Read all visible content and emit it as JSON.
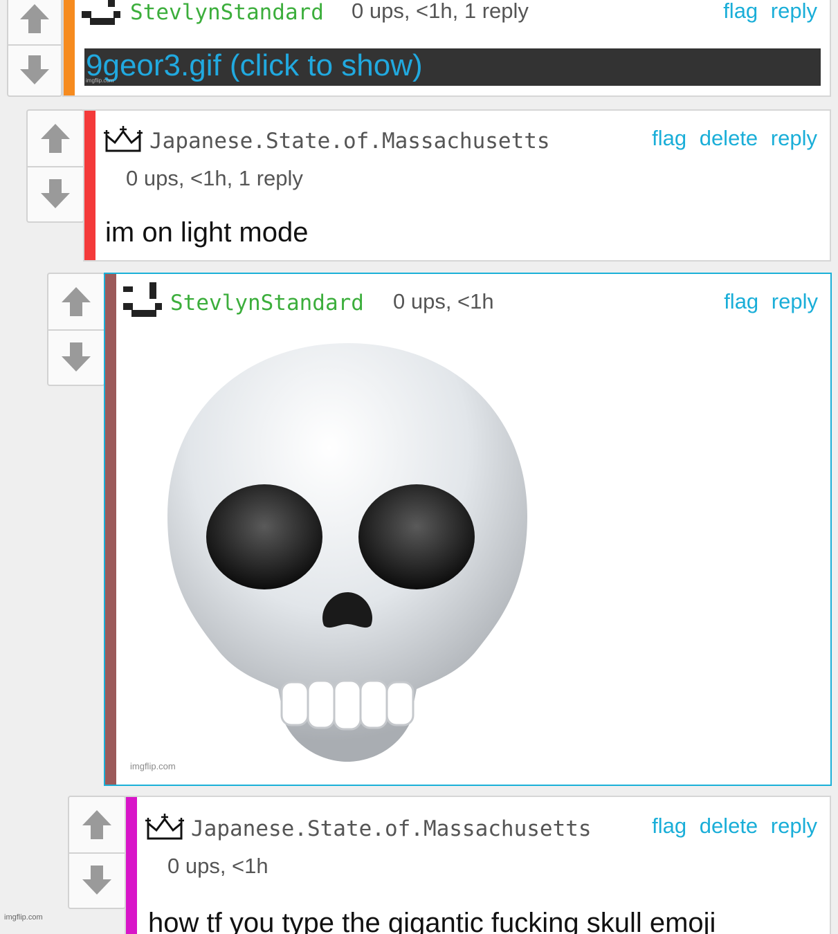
{
  "comments": [
    {
      "user": "StevlynStandard",
      "meta": "0 ups, <1h, 1 reply",
      "actions": [
        "flag",
        "reply"
      ],
      "gif_label": "9geor3.gif (click to show)",
      "watermark": "imgflip.com",
      "bar_color": "#f68b1f"
    },
    {
      "user": "Japanese.State.of.Massachusetts",
      "meta": "0 ups, <1h, 1 reply",
      "actions": [
        "flag",
        "delete",
        "reply"
      ],
      "text": "im on light mode",
      "bar_color": "#f43a3a"
    },
    {
      "user": "StevlynStandard",
      "meta": "0 ups, <1h",
      "actions": [
        "flag",
        "reply"
      ],
      "image": "skull-emoji",
      "watermark": "imgflip.com",
      "bar_color": "#9b5a5a"
    },
    {
      "user": "Japanese.State.of.Massachusetts",
      "meta": "0 ups, <1h",
      "actions": [
        "flag",
        "delete",
        "reply"
      ],
      "text": "how tf you type the gigantic fucking skull emoji",
      "bar_color": "#d815c8"
    }
  ],
  "page_watermark": "imgflip.com",
  "colors": {
    "link": "#1aaed8",
    "username_green": "#3cae3c",
    "highlight_border": "#1ab0d8"
  }
}
